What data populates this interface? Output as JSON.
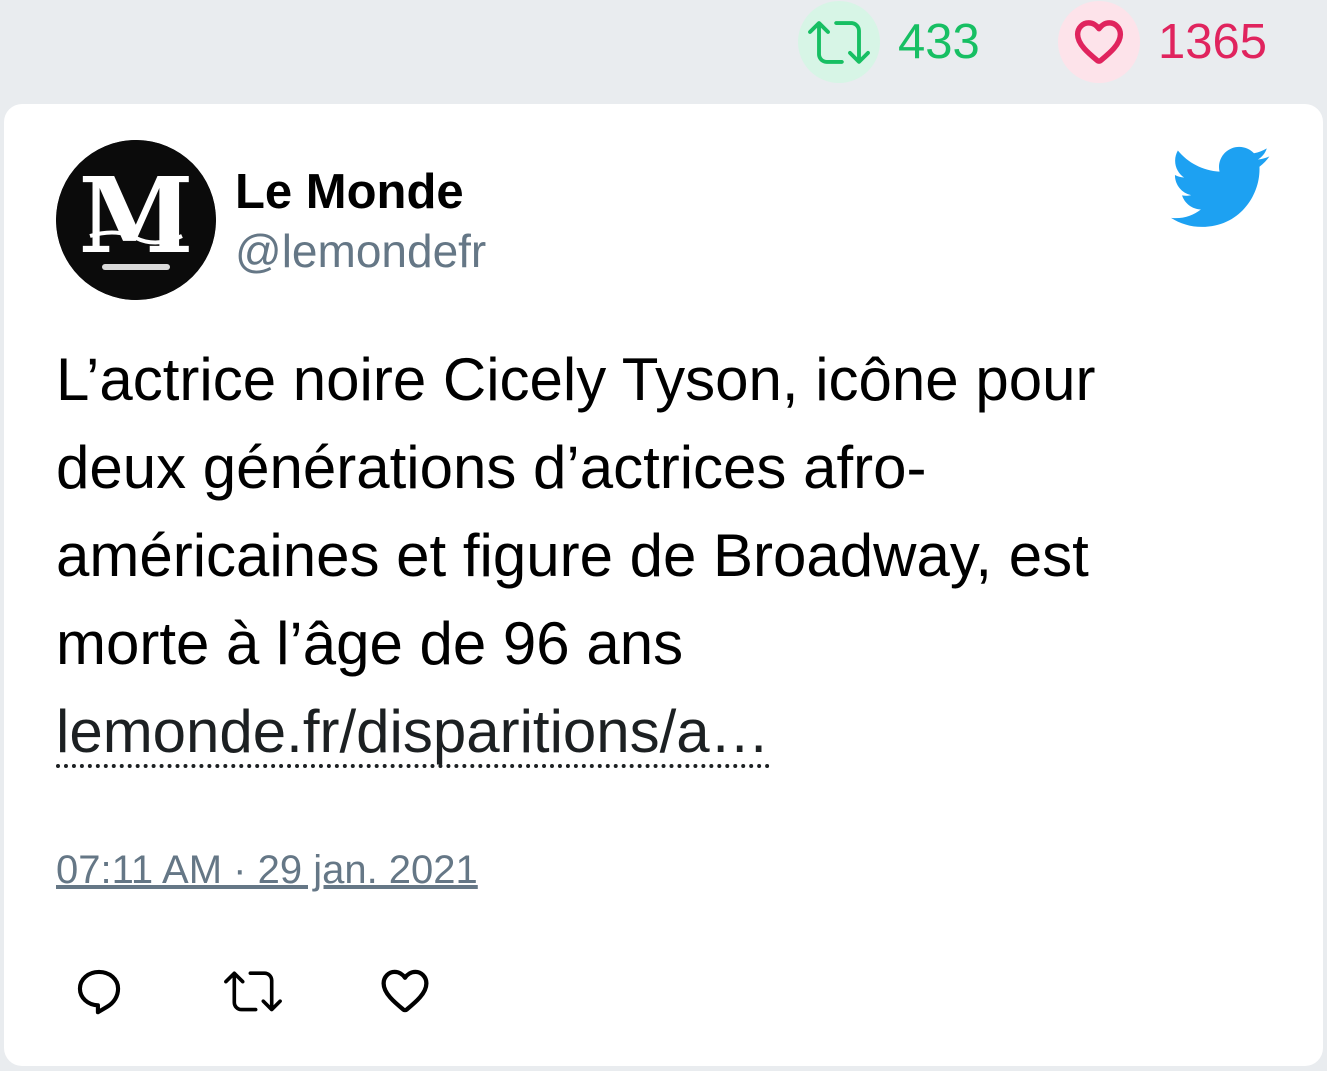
{
  "stats": {
    "retweet_count": "433",
    "like_count": "1365"
  },
  "tweet": {
    "author": {
      "display_name": "Le Monde",
      "handle": "@lemondefr"
    },
    "text_lines": [
      "L’actrice noire Cicely Tyson, icône pour",
      "deux générations d’actrices afro-",
      "américaines et figure de Broadway, est",
      "morte à l’âge de 96 ans"
    ],
    "link_text": "lemonde.fr/disparitions/a…",
    "timestamp": "07:11 AM · 29 jan. 2021"
  },
  "icons": {
    "retweet": "retweet-icon",
    "like": "heart-icon",
    "reply": "reply-icon",
    "brand": "twitter-bird-icon"
  },
  "colors": {
    "retweet": "#17bf63",
    "like": "#e0245e",
    "twitter_blue": "#1da1f2",
    "secondary_text": "#657786",
    "page_background": "#e9ecef"
  }
}
